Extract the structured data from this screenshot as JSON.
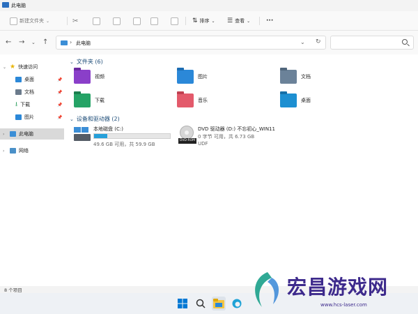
{
  "window": {
    "title": "此电脑"
  },
  "toolbar": {
    "new_label": "新建文件夹",
    "sort_label": "排序",
    "view_label": "查看",
    "more_label": "···"
  },
  "address": {
    "path": "此电脑"
  },
  "search": {
    "placeholder": ""
  },
  "sidebar": {
    "quick_access": "快速访问",
    "items": [
      {
        "label": "桌面",
        "color": "#2b88d8"
      },
      {
        "label": "文档",
        "color": "#6b7b8c"
      },
      {
        "label": "下载",
        "color": "#2a9d5c"
      },
      {
        "label": "图片",
        "color": "#2b88d8"
      }
    ],
    "this_pc": "此电脑",
    "network": "网络"
  },
  "main": {
    "folders_header": "文件夹 (6)",
    "folders": [
      {
        "name": "视频",
        "color": "#8a3fc9"
      },
      {
        "name": "图片",
        "color": "#2b88d8"
      },
      {
        "name": "文档",
        "color": "#6b8299"
      },
      {
        "name": "下载",
        "color": "#25a366"
      },
      {
        "name": "音乐",
        "color": "#e35a6b"
      },
      {
        "name": "桌面",
        "color": "#1d8fd1"
      }
    ],
    "drives_header": "设备和驱动器 (2)",
    "drive_c": {
      "name": "本地磁盘 (C:)",
      "space": "49.6 GB 可用，共 59.9 GB",
      "used_fraction": 0.17
    },
    "drive_d": {
      "name": "DVD 驱动器 (D:) 不忘初心_WIN11",
      "space": "0 字节 可用，共 6.73 GB",
      "fs": "UDF",
      "disc_label": "DVD-ROM"
    }
  },
  "status": {
    "count": "8 个项目"
  },
  "watermark": {
    "text": "宏昌游戏网",
    "url": "www.hcs-laser.com"
  },
  "colors": {
    "accent": "#0067c0",
    "brand": "#3d2a8c"
  }
}
